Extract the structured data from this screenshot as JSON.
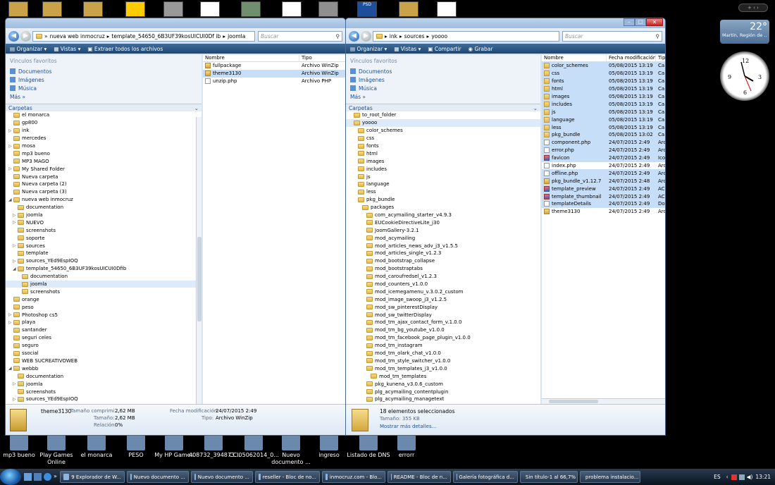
{
  "top_icons": [
    {
      "label": "",
      "color": "#c9a24a"
    },
    {
      "label": "",
      "color": "#c9a24a"
    },
    {
      "label": "",
      "color": "#c9a24a"
    },
    {
      "label": "",
      "color": "#ffcc00"
    },
    {
      "label": "",
      "color": "#999999"
    },
    {
      "label": "",
      "color": "#ffffff"
    },
    {
      "label": "",
      "color": "#6f8f6f"
    },
    {
      "label": "",
      "color": "#ffffff"
    },
    {
      "label": "",
      "color": "#8f8f8f"
    },
    {
      "label": "PSD",
      "color": "#1e4f9a"
    },
    {
      "label": "",
      "color": "#c9a24a"
    },
    {
      "label": "",
      "color": "#ffffff"
    }
  ],
  "desktop_bottom_icons": [
    {
      "label": "mp3 bueno"
    },
    {
      "label": "Play Games Online"
    },
    {
      "label": "el monarca"
    },
    {
      "label": "PESO"
    },
    {
      "label": "My HP Games"
    },
    {
      "label": "408732_394873..."
    },
    {
      "label": "CCI05062014_0..."
    },
    {
      "label": "Nuevo documento ..."
    },
    {
      "label": "ingreso"
    },
    {
      "label": "Listado de DNS"
    },
    {
      "label": "errorr"
    }
  ],
  "gadgets": {
    "temperature": "22°",
    "weather_location": "Martín, Región de ..."
  },
  "left_window": {
    "address": [
      "nueva web inmocruz",
      "template_54650_6B3UF39kosUICUI0Df ib",
      "joomla"
    ],
    "search_placeholder": "Buscar",
    "toolbar": [
      "Organizar",
      "Vistas",
      "Extraer todos los archivos"
    ],
    "fav_title": "Vínculos favoritos",
    "favorites": [
      "Documentos",
      "Imágenes",
      "Música"
    ],
    "more": "Más",
    "folders_label": "Carpetas",
    "tree": [
      {
        "l": "el monarca",
        "d": 1
      },
      {
        "l": "gp800",
        "d": 1
      },
      {
        "l": "ink",
        "d": 1,
        "a": "▷"
      },
      {
        "l": "mercedes",
        "d": 1
      },
      {
        "l": "mosa",
        "d": 1,
        "a": "▷"
      },
      {
        "l": "mp3 bueno",
        "d": 1
      },
      {
        "l": "MP3 MAGO",
        "d": 1
      },
      {
        "l": "My Shared Folder",
        "d": 1,
        "a": "▷"
      },
      {
        "l": "Nueva carpeta",
        "d": 1
      },
      {
        "l": "Nueva carpeta (2)",
        "d": 1
      },
      {
        "l": "Nueva carpeta (3)",
        "d": 1
      },
      {
        "l": "nueva web inmocruz",
        "d": 1,
        "a": "◢"
      },
      {
        "l": "documentation",
        "d": 2
      },
      {
        "l": "joomla",
        "d": 2,
        "a": "▷"
      },
      {
        "l": "NUEVO",
        "d": 2,
        "a": "▷"
      },
      {
        "l": "screenshots",
        "d": 2
      },
      {
        "l": "soporte",
        "d": 2
      },
      {
        "l": "sources",
        "d": 2,
        "a": "▷"
      },
      {
        "l": "template",
        "d": 2
      },
      {
        "l": "sources_YEd9EspIOQ",
        "d": 2,
        "a": "▷"
      },
      {
        "l": "template_54650_6B3UF39kosUICUI0Dfib",
        "d": 2,
        "a": "◢"
      },
      {
        "l": "documentation",
        "d": 3
      },
      {
        "l": "joomla",
        "d": 3,
        "s": true
      },
      {
        "l": "screenshots",
        "d": 3
      },
      {
        "l": "orange",
        "d": 1
      },
      {
        "l": "peso",
        "d": 1
      },
      {
        "l": "Photoshop cs5",
        "d": 1,
        "a": "▷"
      },
      {
        "l": "playa",
        "d": 1,
        "a": "▷"
      },
      {
        "l": "santander",
        "d": 1
      },
      {
        "l": "seguri celes",
        "d": 1
      },
      {
        "l": "seguro",
        "d": 1
      },
      {
        "l": "ssocial",
        "d": 1
      },
      {
        "l": "WEB SUCREATIVOWEB",
        "d": 1
      },
      {
        "l": "webbb",
        "d": 1,
        "a": "◢"
      },
      {
        "l": "documentation",
        "d": 2
      },
      {
        "l": "joomla",
        "d": 2,
        "a": "▷"
      },
      {
        "l": "screenshots",
        "d": 2
      },
      {
        "l": "sources_YEd9EspIOQ",
        "d": 2,
        "a": "▷"
      }
    ],
    "cols": [
      "Nombre",
      "Tipo"
    ],
    "files": [
      {
        "n": "fullpackage",
        "t": "Archivo WinZip",
        "i": "zip"
      },
      {
        "n": "theme3130",
        "t": "Archivo WinZip",
        "i": "zip",
        "s": true
      },
      {
        "n": "unzip.php",
        "t": "Archivo PHP",
        "i": "doc"
      }
    ],
    "details": {
      "name": "theme3130",
      "k1": "Tamaño comprimi...",
      "v1": "2,62 MB",
      "k2": "Tamaño:",
      "v2": "2,62 MB",
      "k3": "Relación:",
      "v3": "0%",
      "k4": "Fecha modificación:",
      "v4": "24/07/2015 2:49",
      "k5": "Tipo:",
      "v5": "Archivo WinZip"
    }
  },
  "right_window": {
    "address": [
      "ink",
      "sources",
      "yoooo"
    ],
    "search_placeholder": "Buscar",
    "toolbar": [
      "Organizar",
      "Vistas",
      "Compartir",
      "Grabar"
    ],
    "fav_title": "Vínculos favoritos",
    "favorites": [
      "Documentos",
      "Imágenes",
      "Música"
    ],
    "more": "Más",
    "folders_label": "Carpetas",
    "tree": [
      {
        "l": "to_root_folder",
        "d": 1
      },
      {
        "l": "yoooo",
        "d": 1,
        "s": true
      },
      {
        "l": "color_schemes",
        "d": 2
      },
      {
        "l": "css",
        "d": 2
      },
      {
        "l": "fonts",
        "d": 2
      },
      {
        "l": "html",
        "d": 2
      },
      {
        "l": "images",
        "d": 2
      },
      {
        "l": "includes",
        "d": 2
      },
      {
        "l": "js",
        "d": 2
      },
      {
        "l": "language",
        "d": 2
      },
      {
        "l": "less",
        "d": 2
      },
      {
        "l": "pkg_bundle",
        "d": 2
      },
      {
        "l": "packages",
        "d": 3
      },
      {
        "l": "com_acymailing_starter_v4.9.3",
        "d": 4
      },
      {
        "l": "EUCookieDirectiveLite_j30",
        "d": 4
      },
      {
        "l": "JoomGallery-3.2.1",
        "d": 4
      },
      {
        "l": "mod_acymailing",
        "d": 4
      },
      {
        "l": "mod_articles_news_adv_j3_v1.5.5",
        "d": 4
      },
      {
        "l": "mod_articles_single_v1.2.3",
        "d": 4
      },
      {
        "l": "mod_bootstrap_collapse",
        "d": 4
      },
      {
        "l": "mod_bootstraptabs",
        "d": 4
      },
      {
        "l": "mod_caroufredsel_v1.2.3",
        "d": 4
      },
      {
        "l": "mod_counters_v1.0.0",
        "d": 4
      },
      {
        "l": "mod_icemegamenu_v.3.0.2_custom",
        "d": 4
      },
      {
        "l": "mod_image_swoop_j3_v1.2.5",
        "d": 4
      },
      {
        "l": "mod_sw_pinterestDisplay",
        "d": 4
      },
      {
        "l": "mod_sw_twitterDisplay",
        "d": 4
      },
      {
        "l": "mod_tm_ajax_contact_form_v.1.0.0",
        "d": 4
      },
      {
        "l": "mod_tm_bg_youtube_v1.0.0",
        "d": 4
      },
      {
        "l": "mod_tm_facebook_page_plugin_v1.0.0",
        "d": 4
      },
      {
        "l": "mod_tm_instagram",
        "d": 4
      },
      {
        "l": "mod_tm_olark_chat_v1.0.0",
        "d": 4
      },
      {
        "l": "mod_tm_style_switcher_v1.0.0",
        "d": 4
      },
      {
        "l": "mod_tm_templates_j3_v1.0.0",
        "d": 4
      },
      {
        "l": "mod_tm_templates",
        "d": 5
      },
      {
        "l": "pkg_kunena_v3.0.6_custom",
        "d": 4
      },
      {
        "l": "plg_acymailing_contentplugin",
        "d": 4
      },
      {
        "l": "plg_acymailing_managetext",
        "d": 4
      }
    ],
    "cols": [
      "Nombre",
      "Fecha modificación",
      "Tip"
    ],
    "files": [
      {
        "n": "color_schemes",
        "f": "05/08/2015 13:19",
        "t": "Ca",
        "i": "folder",
        "s": true
      },
      {
        "n": "css",
        "f": "05/08/2015 13:19",
        "t": "Ca",
        "i": "folder",
        "s": true
      },
      {
        "n": "fonts",
        "f": "05/08/2015 13:19",
        "t": "Ca",
        "i": "folder",
        "s": true
      },
      {
        "n": "html",
        "f": "05/08/2015 13:19",
        "t": "Ca",
        "i": "folder",
        "s": true
      },
      {
        "n": "images",
        "f": "05/08/2015 13:19",
        "t": "Ca",
        "i": "folder",
        "s": true
      },
      {
        "n": "includes",
        "f": "05/08/2015 13:19",
        "t": "Ca",
        "i": "folder",
        "s": true
      },
      {
        "n": "js",
        "f": "05/08/2015 13:19",
        "t": "Ca",
        "i": "folder",
        "s": true
      },
      {
        "n": "language",
        "f": "05/08/2015 13:19",
        "t": "Ca",
        "i": "folder",
        "s": true
      },
      {
        "n": "less",
        "f": "05/08/2015 13:19",
        "t": "Ca",
        "i": "folder",
        "s": true
      },
      {
        "n": "pkg_bundle",
        "f": "05/08/2015 13:02",
        "t": "Ca",
        "i": "folder",
        "s": true
      },
      {
        "n": "component.php",
        "f": "24/07/2015 2:49",
        "t": "Arc",
        "i": "doc",
        "s": true
      },
      {
        "n": "error.php",
        "f": "24/07/2015 2:49",
        "t": "Arc",
        "i": "doc",
        "s": true
      },
      {
        "n": "favicon",
        "f": "24/07/2015 2:49",
        "t": "Ico",
        "i": "img",
        "s": true
      },
      {
        "n": "index.php",
        "f": "24/07/2015 2:49",
        "t": "Arc",
        "i": "doc"
      },
      {
        "n": "offline.php",
        "f": "24/07/2015 2:49",
        "t": "Arc",
        "i": "doc",
        "s": true
      },
      {
        "n": "pkg_bundle_v1.12.7",
        "f": "24/07/2015 2:48",
        "t": "Arc",
        "i": "zip",
        "s": true
      },
      {
        "n": "template_preview",
        "f": "24/07/2015 2:49",
        "t": "AC",
        "i": "img",
        "s": true
      },
      {
        "n": "template_thumbnail",
        "f": "24/07/2015 2:49",
        "t": "AC",
        "i": "img",
        "s": true
      },
      {
        "n": "templateDetails",
        "f": "24/07/2015 2:49",
        "t": "Doc",
        "i": "doc",
        "s": true
      },
      {
        "n": "theme3130",
        "f": "24/07/2015 2:49",
        "t": "Arc",
        "i": "zip"
      }
    ],
    "details": {
      "line1": "18 elementos seleccionados",
      "line2": "Tamaño: 355 KB",
      "line3": "Mostrar más detalles..."
    }
  },
  "taskbar": {
    "items": [
      "9 Explorador de W...",
      "Nuevo documento ...",
      "Nuevo documento ...",
      "reseller - Bloc de no...",
      "inmocruz.com - Blo...",
      "README - Bloc de n...",
      "Galería fotográfica d...",
      "Sin título-1 al 66,7% ...",
      "problema instalacio..."
    ],
    "lang": "ES",
    "time": "13:21"
  }
}
